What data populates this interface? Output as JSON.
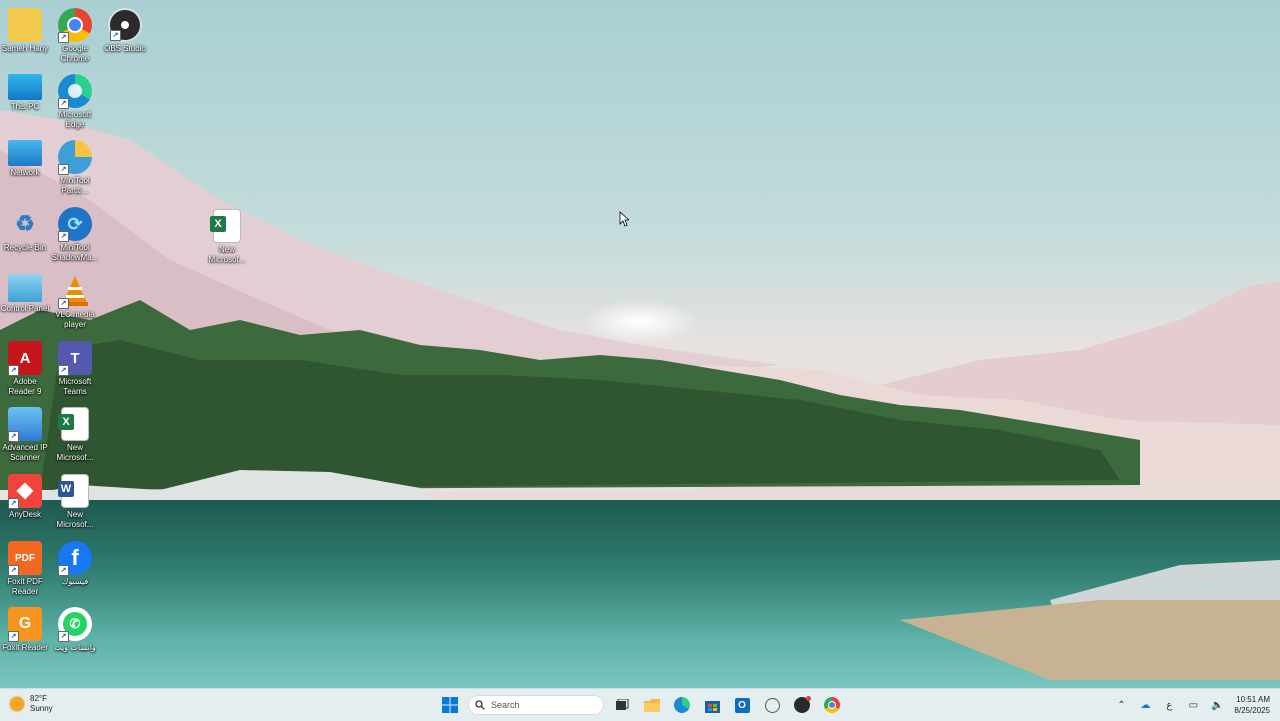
{
  "desktop": {
    "icons": [
      {
        "label": "Sameh Hany",
        "icon": "folder-icon",
        "color": "#f2c94c"
      },
      {
        "label": "Google Chrome",
        "icon": "chrome-icon",
        "color": "#4285f4"
      },
      {
        "label": "OBS Studio",
        "icon": "obs-icon",
        "color": "#2b2b2b"
      },
      {
        "label": "This PC",
        "icon": "monitor-icon",
        "color": "#28a8e0"
      },
      {
        "label": "Microsoft Edge",
        "icon": "edge-icon",
        "color": "#1a8ad4"
      },
      {
        "label": "Network",
        "icon": "network-icon",
        "color": "#2f9be0"
      },
      {
        "label": "MiniTool Partiti...",
        "icon": "minitool-partition-icon",
        "color": "#3d9fd8"
      },
      {
        "label": "Recycle Bin",
        "icon": "recycle-bin-icon",
        "color": "#8fb9d8"
      },
      {
        "label": "MiniTool ShadowMa...",
        "icon": "minitool-shadowmaker-icon",
        "color": "#1f74c8"
      },
      {
        "label": "New Microsof...",
        "icon": "excel-icon",
        "color": "#1d7a45"
      },
      {
        "label": "Control Panel",
        "icon": "control-panel-icon",
        "color": "#3da2d6"
      },
      {
        "label": "VLC media player",
        "icon": "vlc-icon",
        "color": "#f08c00"
      },
      {
        "label": "Adobe Reader 9",
        "icon": "adobe-reader-icon",
        "color": "#c4161c"
      },
      {
        "label": "Microsoft Teams",
        "icon": "teams-icon",
        "color": "#5558af"
      },
      {
        "label": "Advanced IP Scanner",
        "icon": "ip-scanner-icon",
        "color": "#2e7bd6"
      },
      {
        "label": "New Microsof...",
        "icon": "excel-icon",
        "color": "#1d7a45"
      },
      {
        "label": "AnyDesk",
        "icon": "anydesk-icon",
        "color": "#ef443b"
      },
      {
        "label": "New Microsof...",
        "icon": "word-icon",
        "color": "#2b5797"
      },
      {
        "label": "Foxit PDF Reader",
        "icon": "foxit-pdf-icon",
        "color": "#f26722"
      },
      {
        "label": "فيسبوك",
        "icon": "facebook-icon",
        "color": "#1877f2"
      },
      {
        "label": "Foxit Reader",
        "icon": "foxit-reader-icon",
        "color": "#f7941d"
      },
      {
        "label": "واتساب ويب",
        "icon": "whatsapp-icon",
        "color": "#25d366"
      }
    ]
  },
  "taskbar": {
    "weather": {
      "temp": "82°F",
      "condition": "Sunny"
    },
    "search_placeholder": "Search",
    "apps": [
      {
        "name": "start-button",
        "icon": "windows-logo-icon"
      },
      {
        "name": "task-view",
        "icon": "task-view-icon"
      },
      {
        "name": "file-explorer",
        "icon": "folder-icon"
      },
      {
        "name": "edge",
        "icon": "edge-icon"
      },
      {
        "name": "microsoft-store",
        "icon": "store-icon"
      },
      {
        "name": "outlook",
        "icon": "outlook-icon"
      },
      {
        "name": "whatsapp",
        "icon": "whatsapp-icon"
      },
      {
        "name": "obs",
        "icon": "obs-icon"
      },
      {
        "name": "chrome",
        "icon": "chrome-icon"
      }
    ],
    "clock": {
      "time": "10:51 AM",
      "date": "8/25/2025"
    }
  }
}
